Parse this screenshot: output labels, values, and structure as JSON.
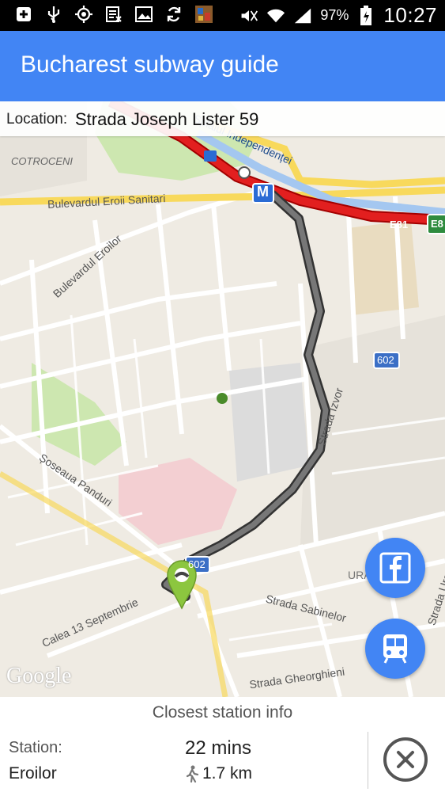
{
  "statusbar": {
    "battery": "97%",
    "time": "10:27"
  },
  "app": {
    "title": "Bucharest subway guide"
  },
  "location": {
    "label": "Location:",
    "value": "Strada Joseph Lister 59"
  },
  "map": {
    "labels": {
      "cotroceni": "COTROCENI",
      "independentei": "Splaiul Independenței",
      "eroii_sanitari": "Bulevardul Eroii Sanitari",
      "eroilor": "Bulevardul Eroilor",
      "soseaua_panduri": "Șoseaua Panduri",
      "strada_izvor": "Strada Izvor",
      "calea_13": "Calea 13 Septembrie",
      "strada_sabinelor": "Strada Sabinelor",
      "strada_gheorghieni": "Strada Gheorghieni",
      "strada_uranus": "Strada Uranus",
      "e81": "E81",
      "e8": "E8",
      "r602_a": "602",
      "r602_b": "602",
      "ura": "URA",
      "metro": "M"
    },
    "google": "Google"
  },
  "colors": {
    "appbar": "#4285f4",
    "route": "#555555",
    "highway": "#e21f1f",
    "marker": "#8cc63f"
  },
  "info": {
    "header": "Closest station info",
    "station_label": "Station:",
    "station_name": "Eroilor",
    "time": "22 mins",
    "distance": "1.7 km"
  }
}
